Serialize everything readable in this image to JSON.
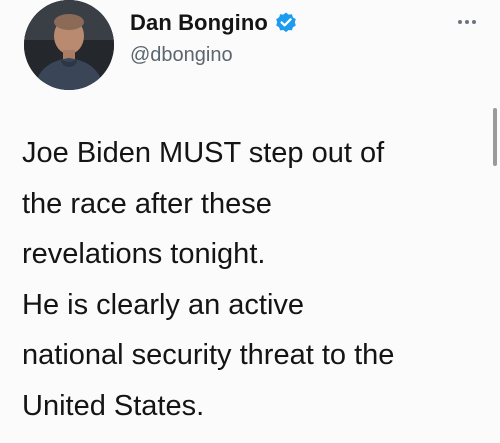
{
  "author": {
    "display_name": "Dan Bongino",
    "handle": "@dbongino",
    "verified": true,
    "verified_color": "#1d9bf0"
  },
  "menu": {
    "icon": "more-horizontal-icon"
  },
  "tweet": {
    "lines": [
      "Joe Biden MUST step out of",
      "the race after these",
      "revelations tonight.",
      "He is clearly an active",
      "national security threat to the",
      "United States."
    ]
  }
}
